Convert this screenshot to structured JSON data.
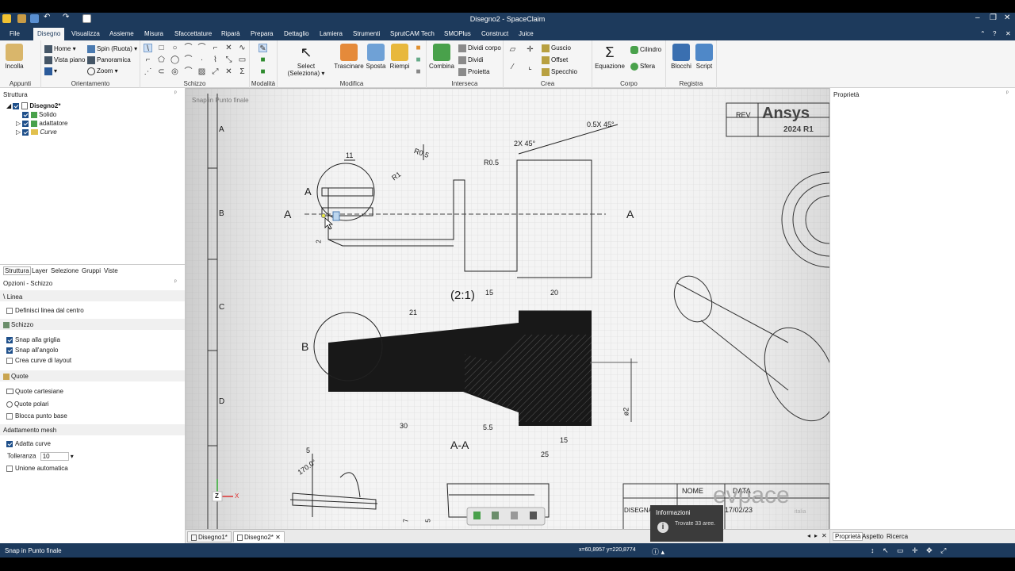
{
  "window": {
    "title": "Disegno2 - SpaceClaim"
  },
  "menu": [
    "File",
    "Disegno",
    "Visualizza",
    "Assieme",
    "Misura",
    "Sfaccettature",
    "Riparà",
    "Prepara",
    "Dettaglio",
    "Lamiera",
    "Strumenti",
    "SprutCAM Tech",
    "SMOPlus",
    "Construct",
    "Juice"
  ],
  "ribbon": {
    "appunti": {
      "label": "Appunti",
      "paste": "Incolla"
    },
    "orientamento": {
      "label": "Orientamento",
      "home": "Home",
      "spin": "Spin (Ruota)",
      "plan": "Vista piano",
      "pan": "Panoramica",
      "zoom": "Zoom"
    },
    "schizzo": {
      "label": "Schizzo"
    },
    "modalita": {
      "label": "Modalità"
    },
    "modifica": {
      "label": "Modifica",
      "select": "Select (Seleziona)",
      "pull": "Trascinare",
      "move": "Sposta",
      "fill": "Riempi"
    },
    "interseca": {
      "label": "Interseca",
      "combine": "Combina",
      "split_body": "Dividi corpo",
      "split": "Dividi",
      "project": "Proietta"
    },
    "crea": {
      "label": "Crea",
      "shell": "Guscio",
      "offset": "Offset",
      "mirror": "Specchio"
    },
    "corpo": {
      "label": "Corpo",
      "equation": "Equazione",
      "cylinder": "Cilindro",
      "sphere": "Sfera"
    },
    "registra": {
      "label": "Registra",
      "blocks": "Blocchi",
      "script": "Script"
    }
  },
  "structure": {
    "title": "Struttura",
    "items": [
      {
        "label": "Disegno2*"
      },
      {
        "label": "Solido"
      },
      {
        "label": "adattatore"
      },
      {
        "label": "Curve"
      }
    ],
    "tabs": [
      "Struttura",
      "Layer",
      "Selezione",
      "Gruppi",
      "Viste"
    ]
  },
  "options": {
    "title": "Opzioni - Schizzo",
    "linea": "Linea",
    "define_center": "Definisci linea dal centro",
    "schizzo": "Schizzo",
    "snap_grid": "Snap alla griglia",
    "snap_angle": "Snap all'angolo",
    "layout_curves": "Crea curve di layout",
    "quote": "Quote",
    "cartesian": "Quote cartesiane",
    "polar": "Quote polari",
    "lock_base": "Blocca punto base",
    "mesh": "Adattamento mesh",
    "fit_curves": "Adatta curve",
    "tolerance_label": "Tolleranza",
    "tolerance_value": "10",
    "auto_merge": "Unione automatica"
  },
  "canvas": {
    "snap_hint": "Snap in Punto finale",
    "rows": [
      "A",
      "B",
      "C",
      "D"
    ],
    "title_block": {
      "rev": "REV",
      "brand": "Ansys",
      "release": "2024 R1",
      "name": "NOME",
      "date_label": "DATA",
      "date": "17/02/23",
      "designer": "DISEGNA",
      "logo": "evpace",
      "logo_sub": "italia"
    },
    "dims": {
      "d11": "11",
      "r05a": "R0.5",
      "r05b": "R0.5",
      "r1": "R1",
      "ch2x45": "2X 45°",
      "ch05": "0.5X 45°",
      "scale": "(2:1)",
      "d15a": "15",
      "d20": "20",
      "d21": "21",
      "d30": "30",
      "d55": "5.5",
      "d15b": "15",
      "d25": "25",
      "d5": "5",
      "ang170": "170.0°",
      "phi2": "ø2",
      "num2": "2",
      "num7": "7",
      "num5": "5"
    },
    "labels": {
      "secA_left": "A",
      "secA_right": "A",
      "secA_top": "A",
      "detail_b": "B",
      "section": "A-A"
    },
    "axis": {
      "z": "Z",
      "x": "X"
    }
  },
  "tabs": {
    "doc1": "Disegno1*",
    "doc2": "Disegno2*"
  },
  "right": {
    "title": "Proprietà",
    "tabs": [
      "Proprietà",
      "Aspetto",
      "Ricerca"
    ]
  },
  "notification": {
    "title": "Informazioni",
    "text": "Trovate 33 aree."
  },
  "status": {
    "text": "Snap in Punto finale",
    "coords": "x=60,8957  y=220,8774"
  },
  "colors": {
    "chrome": "#1d3a5c",
    "ribbon": "#f5f5f5",
    "canvas_grid": "#d0d0d0",
    "accent": "#1e4f8a"
  }
}
